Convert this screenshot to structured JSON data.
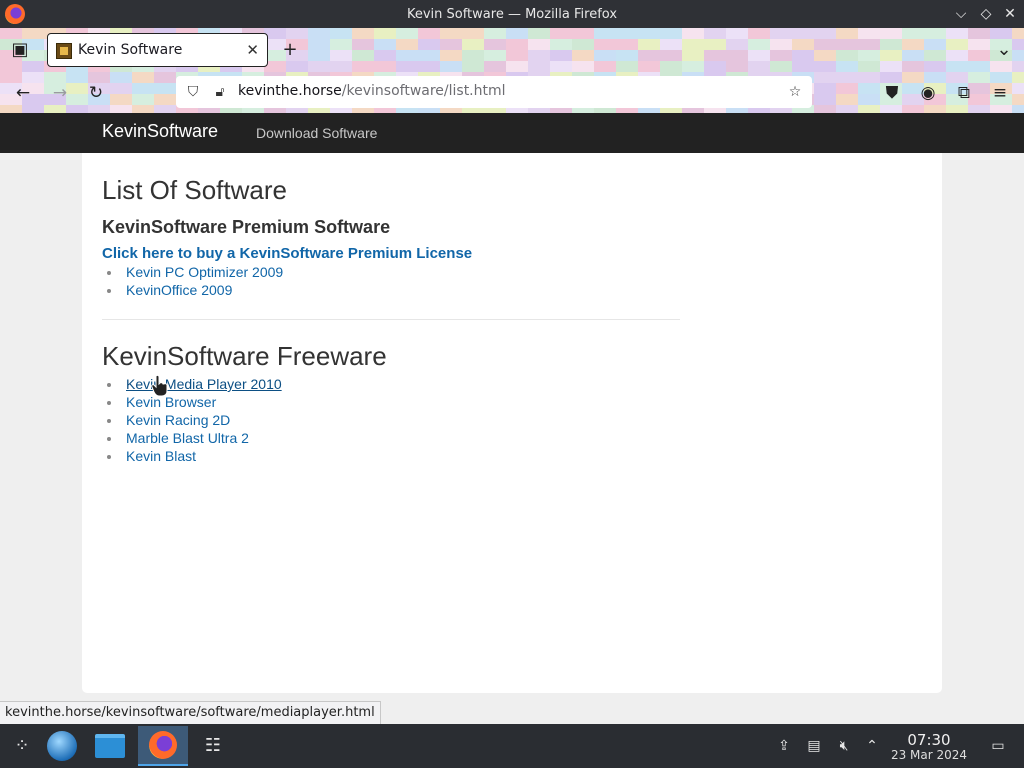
{
  "window": {
    "title": "Kevin Software — Mozilla Firefox",
    "controls": [
      "chevron-down-icon",
      "diamond-icon",
      "close-icon"
    ]
  },
  "tabs": [
    {
      "label": "Kevin Software",
      "active": true
    }
  ],
  "navbar": {
    "url_host": "kevinthe.horse",
    "url_path": "/kevinsoftware/list.html"
  },
  "site": {
    "brand": "KevinSoftware",
    "nav_link": "Download Software",
    "heading": "List Of Software",
    "premium_heading": "KevinSoftware Premium Software",
    "buy_link": "Click here to buy a KevinSoftware Premium License",
    "premium_items": [
      "Kevin PC Optimizer 2009",
      "KevinOffice 2009"
    ],
    "freeware_heading": "KevinSoftware Freeware",
    "freeware_items": [
      "Kevin Media Player 2010",
      "Kevin Browser",
      "Kevin Racing 2D",
      "Marble Blast Ultra 2",
      "Kevin Blast"
    ],
    "hovered_item": "Kevin Media Player 2010"
  },
  "statusbar": {
    "text": "kevinthe.horse/kevinsoftware/software/mediaplayer.html"
  },
  "taskbar": {
    "time": "07:30",
    "date": "23 Mar 2024"
  },
  "colors": {
    "link": "#1166a8",
    "site_nav_bg": "#222222",
    "accent": "#4ea4e8"
  }
}
